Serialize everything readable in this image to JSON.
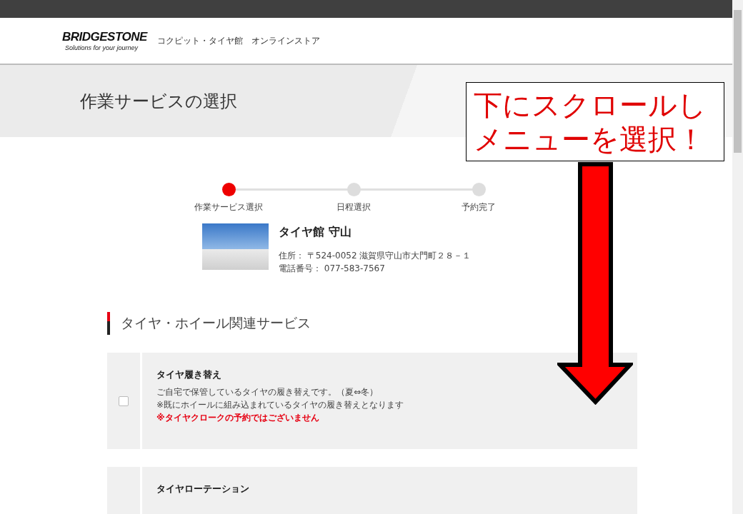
{
  "header": {
    "logo_text": "BRIDGESTONE",
    "logo_tagline": "Solutions for your journey",
    "site_name": "コクピット・タイヤ館　オンラインストア"
  },
  "page_title": "作業サービスの選択",
  "steps": [
    {
      "label": "作業サービス選択",
      "selected": true
    },
    {
      "label": "日程選択",
      "selected": false
    },
    {
      "label": "予約完了",
      "selected": false
    }
  ],
  "store": {
    "name": "タイヤ館 守山",
    "address": "住所： 〒524-0052 滋賀県守山市大門町２８－１",
    "phone": "電話番号： 077-583-7567"
  },
  "section_title": "タイヤ・ホイール関連サービス",
  "services": [
    {
      "title": "タイヤ履き替え",
      "checked": false,
      "lines": [
        {
          "kind": "note",
          "text": "ご自宅で保管しているタイヤの履き替えです。（夏⇔冬）"
        },
        {
          "kind": "note",
          "text": "※既にホイールに組み込まれているタイヤの履き替えとなります"
        },
        {
          "kind": "warning",
          "text": "※タイヤクロークの予約ではございません"
        }
      ]
    },
    {
      "title": "タイヤローテーション"
    }
  ],
  "annotation": {
    "lines": [
      "下にスクロールし",
      "メニューを選択！"
    ]
  }
}
